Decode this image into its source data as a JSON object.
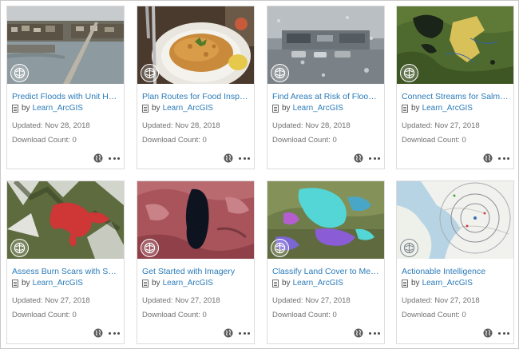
{
  "cards": [
    {
      "title": "Predict Floods with Unit Hy…",
      "by": "by",
      "owner": "Learn_ArcGIS",
      "updated": "Updated: Nov 28, 2018",
      "downloads": "Download Count: 0",
      "thumb": "flood-village"
    },
    {
      "title": "Plan Routes for Food Inspe…",
      "by": "by",
      "owner": "Learn_ArcGIS",
      "updated": "Updated: Nov 28, 2018",
      "downloads": "Download Count: 0",
      "thumb": "food-plate"
    },
    {
      "title": "Find Areas at Risk of Floodi…",
      "by": "by",
      "owner": "Learn_ArcGIS",
      "updated": "Updated: Nov 28, 2018",
      "downloads": "Download Count: 0",
      "thumb": "rainy-street"
    },
    {
      "title": "Connect Streams for Salmo…",
      "by": "by",
      "owner": "Learn_ArcGIS",
      "updated": "Updated: Nov 27, 2018",
      "downloads": "Download Count: 0",
      "thumb": "forest-map"
    },
    {
      "title": "Assess Burn Scars with Sate…",
      "by": "by",
      "owner": "Learn_ArcGIS",
      "updated": "Updated: Nov 27, 2018",
      "downloads": "Download Count: 0",
      "thumb": "burn-scar"
    },
    {
      "title": "Get Started with Imagery",
      "by": "by",
      "owner": "Learn_ArcGIS",
      "updated": "Updated: Nov 27, 2018",
      "downloads": "Download Count: 0",
      "thumb": "lake-imagery"
    },
    {
      "title": "Classify Land Cover to Mea…",
      "by": "by",
      "owner": "Learn_ArcGIS",
      "updated": "Updated: Nov 27, 2018",
      "downloads": "Download Count: 0",
      "thumb": "land-cover"
    },
    {
      "title": "Actionable Intelligence",
      "by": "by",
      "owner": "Learn_ArcGIS",
      "updated": "Updated: Nov 27, 2018",
      "downloads": "Download Count: 0",
      "thumb": "coast-map"
    }
  ],
  "icons": {
    "badge": "learn-arcgis-logo-icon",
    "share": "globe-icon",
    "menu": "more-options-icon"
  },
  "colors": {
    "link": "#2b7bb9",
    "text": "#4c4c4c",
    "muted": "#737373",
    "border": "#dcdcdc"
  }
}
